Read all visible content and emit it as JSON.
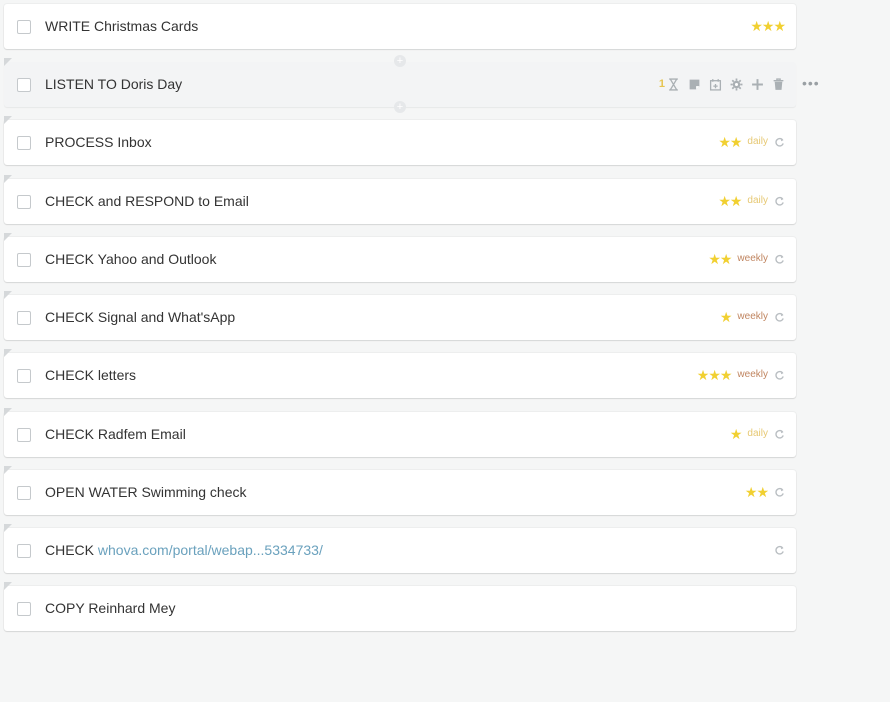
{
  "colors": {
    "star": "#f1d031",
    "daily": "#e6c873",
    "weekly": "#c08560",
    "link": "#6aa1bd"
  },
  "tasks": [
    {
      "title": "WRITE Christmas Cards",
      "stars": 3
    },
    {
      "title": "LISTEN TO Doris Day",
      "hover": true,
      "count": "1"
    },
    {
      "title": "PROCESS Inbox",
      "stars": 2,
      "repeat": "daily"
    },
    {
      "title": "CHECK and RESPOND to Email",
      "stars": 2,
      "repeat": "daily"
    },
    {
      "title": "CHECK Yahoo and Outlook",
      "stars": 2,
      "repeat": "weekly"
    },
    {
      "title": "CHECK Signal and What'sApp",
      "stars": 1,
      "repeat": "weekly"
    },
    {
      "title": "CHECK letters",
      "stars": 3,
      "repeat": "weekly"
    },
    {
      "title": "CHECK Radfem Email",
      "stars": 1,
      "repeat": "daily"
    },
    {
      "title": "OPEN WATER Swimming check",
      "stars": 2,
      "repeat_icon": true
    },
    {
      "title": "CHECK",
      "link": "whova.com/portal/webap...5334733/",
      "repeat_icon": true
    },
    {
      "title": "COPY Reinhard Mey"
    }
  ],
  "hover_actions": [
    "hourglass-icon",
    "note-icon",
    "calendar-add-icon",
    "gear-icon",
    "plus-icon",
    "trash-icon"
  ],
  "more_label": "•••"
}
